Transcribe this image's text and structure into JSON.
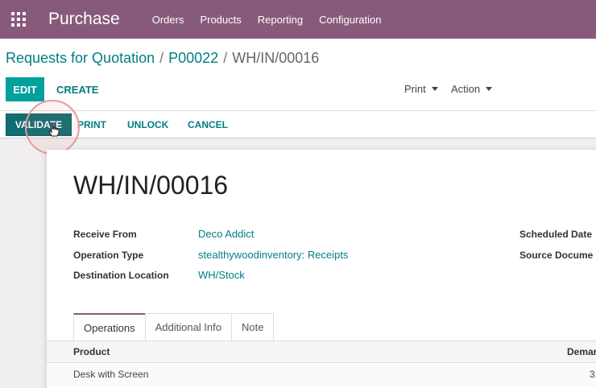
{
  "topbar": {
    "app_title": "Purchase",
    "menu": [
      "Orders",
      "Products",
      "Reporting",
      "Configuration"
    ],
    "color": "#875a7b"
  },
  "breadcrumb": {
    "items": [
      "Requests for Quotation",
      "P00022"
    ],
    "current": "WH/IN/00016"
  },
  "control": {
    "edit_label": "EDIT",
    "create_label": "CREATE",
    "print_label": "Print",
    "action_label": "Action"
  },
  "statusbar": {
    "validate_label": "VALIDATE",
    "print_label": "PRINT",
    "unlock_label": "UNLOCK",
    "cancel_label": "CANCEL"
  },
  "record": {
    "title": "WH/IN/00016",
    "fields": [
      {
        "label": "Receive From",
        "value": "Deco Addict"
      },
      {
        "label": "Operation Type",
        "value": "stealthywoodinventory: Receipts"
      },
      {
        "label": "Destination Location",
        "value": "WH/Stock"
      }
    ],
    "right_fields": [
      "Scheduled Date",
      "Source Docume"
    ]
  },
  "tabs": [
    "Operations",
    "Additional Info",
    "Note"
  ],
  "table": {
    "columns": [
      "Product",
      "Demar"
    ],
    "rows": [
      {
        "product": "Desk with Screen",
        "demand": "3."
      }
    ]
  },
  "accent_color": "#017e84"
}
